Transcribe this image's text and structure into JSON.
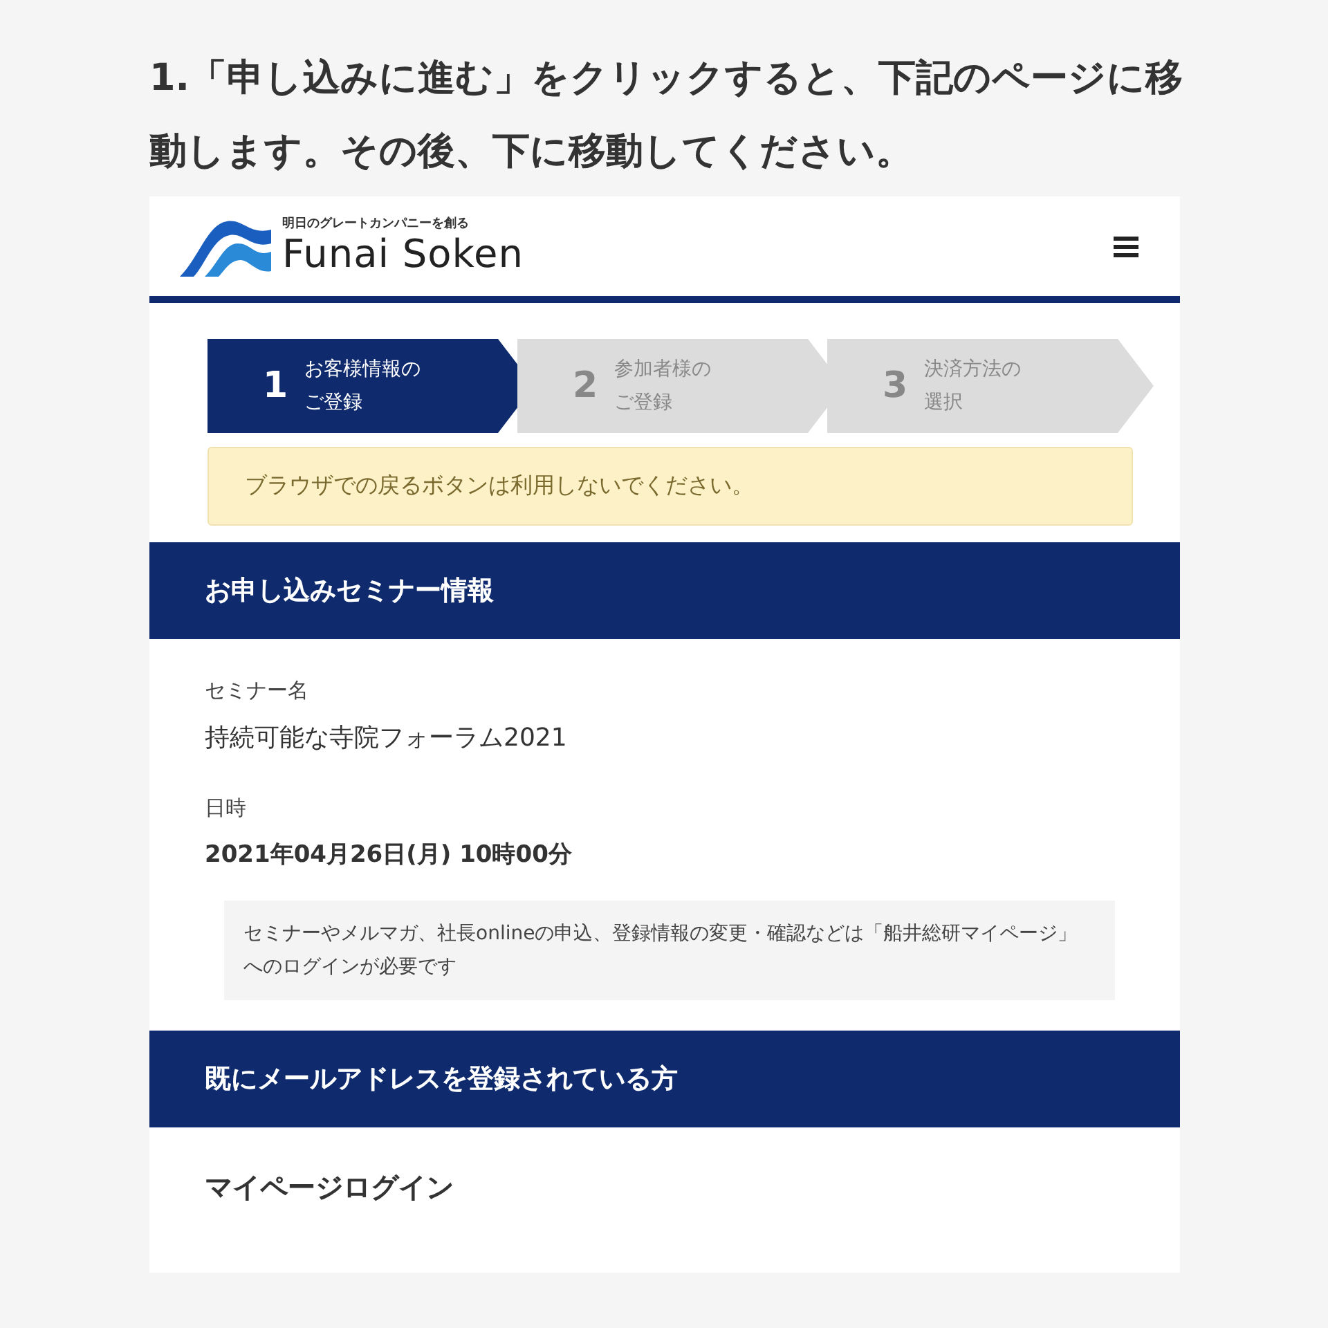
{
  "instruction": "1.「申し込みに進む」をクリックすると、下記のページに移動します。その後、下に移動してください。",
  "header": {
    "tagline": "明日のグレートカンパニーを創る",
    "brand": "Funai Soken"
  },
  "steps": [
    {
      "number": "1",
      "label_lines": [
        "お客様情報の",
        "ご登録"
      ],
      "selected": true
    },
    {
      "number": "2",
      "label_lines": [
        "参加者様の",
        "ご登録"
      ],
      "selected": false
    },
    {
      "number": "3",
      "label_lines": [
        "決済方法の",
        "選択"
      ],
      "selected": false
    }
  ],
  "warning": "ブラウザでの戻るボタンは利用しないでください。",
  "seminar_section": {
    "title": "お申し込みセミナー情報",
    "fields": [
      {
        "label": "セミナー名",
        "value": "持続可能な寺院フォーラム2021"
      },
      {
        "label": "日時",
        "value": "2021年04月26日(月) 10時00分"
      }
    ],
    "note": "セミナーやメルマガ、社長onlineの申込、登録情報の変更・確認などは「船井総研マイページ」へのログインが必要です"
  },
  "login_section": {
    "title": "既にメールアドレスを登録されている方",
    "subtitle": "マイページログイン"
  }
}
